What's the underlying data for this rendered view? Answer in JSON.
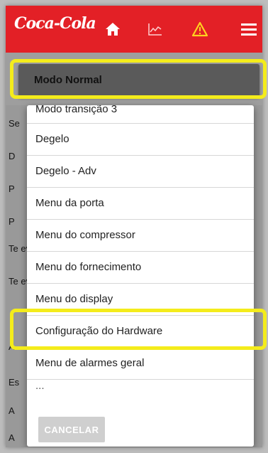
{
  "colors": {
    "appbar": "#e32026",
    "highlight": "#f4ec1b"
  },
  "appbar": {
    "logo_text": "Coca-Cola",
    "icons": [
      "home-icon",
      "chart-icon",
      "warning-icon",
      "menu-icon"
    ]
  },
  "underlay": {
    "rows": [
      "Se",
      "D",
      "P",
      "P",
      "Te ev",
      "Te ev",
      "A",
      "Es",
      "A",
      "A"
    ]
  },
  "mode_select": {
    "value": "Modo Normal"
  },
  "dialog": {
    "options": [
      "Modo transição 3",
      "Degelo",
      "Degelo - Adv",
      "Menu da porta",
      "Menu do compressor",
      "Menu do fornecimento",
      "Menu do display",
      "Configuração do Hardware",
      "Menu de alarmes geral",
      "..."
    ],
    "cancel_label": "CANCELAR"
  }
}
